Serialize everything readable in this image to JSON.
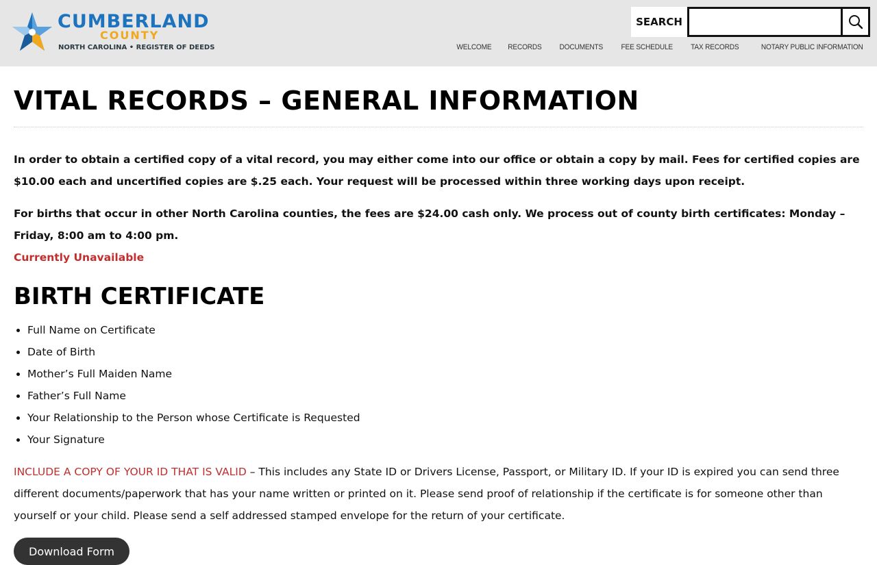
{
  "header": {
    "logo": {
      "name": "CUMBERLAND",
      "county": "COUNTY",
      "subtitle": "NORTH CAROLINA • REGISTER OF DEEDS",
      "colors": {
        "blue": "#1e73be",
        "gold": "#f0a81c"
      }
    },
    "search": {
      "label": "SEARCH",
      "placeholder": "",
      "value": "",
      "button_icon": "search-icon"
    },
    "nav": [
      {
        "label": "WELCOME"
      },
      {
        "label": "RECORDS"
      },
      {
        "label": "DOCUMENTS"
      },
      {
        "label": "FEE SCHEDULE"
      },
      {
        "label": "TAX RECORDS"
      },
      {
        "label": "NOTARY PUBLIC INFORMATION"
      }
    ]
  },
  "main": {
    "title": "VITAL RECORDS – GENERAL INFORMATION",
    "intro": "In order to obtain a certified copy of a vital record, you may either come into our office or obtain a copy by mail. Fees for certified copies are $10.00 each and uncertified copies are $.25 each. Your request will be processed within three working days upon receipt.",
    "intro2": "For births that occur in other North Carolina counties, the fees are $24.00 cash only.  We process out of county birth certificates: Monday – Friday, 8:00 am to 4:00 pm.",
    "unavailable": "Currently Unavailable",
    "birth_heading": "BIRTH CERTIFICATE",
    "birth_items": [
      "Full Name on Certificate",
      "Date of Birth",
      "Mother’s Full Maiden Name",
      "Father’s Full Name",
      "Your Relationship to the Person whose Certificate is Requested",
      "Your Signature"
    ],
    "id_notice_red": "INCLUDE A COPY OF YOUR ID THAT IS VALID",
    "id_notice_rest": " – This includes any State ID or Drivers License, Passport, or Military ID. If your ID is expired you can send three different documents/paperwork that has your name written or printed on it. Please send proof of relationship if the certificate is for someone other than yourself or your child.  Please send a self addressed stamped envelope for the return of your certificate.",
    "download_button": "Download Form",
    "accent_red": "#c22d2d"
  }
}
